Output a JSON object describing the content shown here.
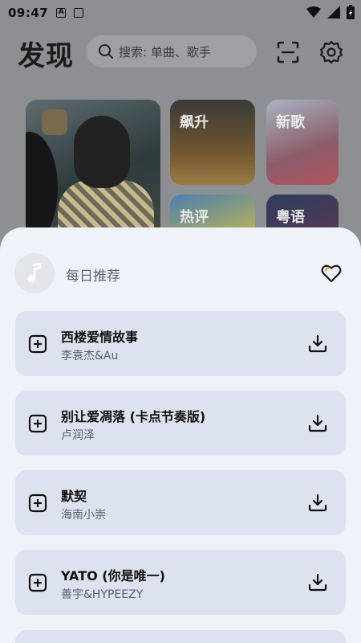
{
  "status_bar": {
    "time": "09:47",
    "notif_icons": [
      "a-icon",
      "square-icon"
    ],
    "right_icons": [
      "wifi-icon",
      "signal-icon",
      "battery-charging-icon"
    ]
  },
  "header": {
    "title": "发现",
    "search_placeholder": "搜索: 单曲、歌手",
    "icons": [
      "scan-icon",
      "settings-icon"
    ]
  },
  "categories": [
    {
      "label": "飙升"
    },
    {
      "label": "新歌"
    },
    {
      "label": "热评"
    },
    {
      "label": "粤语"
    }
  ],
  "sheet": {
    "title": "每日推荐",
    "songs": [
      {
        "name": "西楼爱情故事",
        "artist": "李袁杰&Au"
      },
      {
        "name": "别让爱凋落 (卡点节奏版)",
        "artist": "卢润泽"
      },
      {
        "name": "默契",
        "artist": "海南小崇"
      },
      {
        "name": "YATO (你是唯一)",
        "artist": "善宇&HYPEEZY"
      }
    ]
  }
}
